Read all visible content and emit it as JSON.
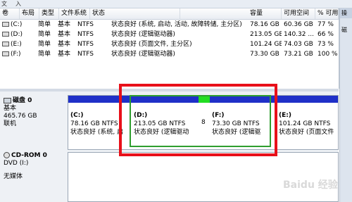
{
  "window": {
    "title_fragments": [
      "文",
      "入"
    ]
  },
  "volume_list": {
    "headers": [
      "卷",
      "布局",
      "类型",
      "文件系统",
      "状态",
      "容量",
      "可用空间",
      "% 可用"
    ],
    "rows": [
      {
        "vol": "(C:)",
        "layout": "简单",
        "type": "基本",
        "fs": "NTFS",
        "status": "状态良好 (系统, 启动, 活动, 故障转储, 主分区)",
        "capacity": "78.16 GB",
        "free": "60.36 GB",
        "pct": "77 %"
      },
      {
        "vol": "(D:)",
        "layout": "简单",
        "type": "基本",
        "fs": "NTFS",
        "status": "状态良好 (逻辑驱动器)",
        "capacity": "213.05 GB",
        "free": "140.32 ...",
        "pct": "66 %"
      },
      {
        "vol": "(E:)",
        "layout": "简单",
        "type": "基本",
        "fs": "NTFS",
        "status": "状态良好 (页面文件, 主分区)",
        "capacity": "101.24 GB",
        "free": "74.03 GB",
        "pct": "73 %"
      },
      {
        "vol": "(F:)",
        "layout": "简单",
        "type": "基本",
        "fs": "NTFS",
        "status": "状态良好 (逻辑驱动器)",
        "capacity": "73.30 GB",
        "free": "73.21 GB",
        "pct": "100 %"
      }
    ]
  },
  "actions": {
    "header": "操",
    "item": "磁"
  },
  "disk0": {
    "name": "磁盘 0",
    "type": "基本",
    "size": "465.76 GB",
    "state": "联机",
    "partitions": [
      {
        "label": "(C:)",
        "size": "78.16 GB NTFS",
        "status": "状态良好 (系统, 启",
        "bar": "#1f30c8"
      },
      {
        "label": "(D:)",
        "size": "213.05 GB NTFS",
        "status": "状态良好 (逻辑驱动",
        "bar": "#1f30c8"
      },
      {
        "label": "",
        "size": "8",
        "status": "",
        "bar": "#22dd22"
      },
      {
        "label": "(F:)",
        "size": "73.30 GB NTFS",
        "status": "状态良好 (逻辑驱",
        "bar": "#1f30c8"
      },
      {
        "label": "(E:)",
        "size": "101.24 GB NTFS",
        "status": "状态良好 (页面文件",
        "bar": "#1f30c8"
      }
    ]
  },
  "cdrom0": {
    "name": "CD-ROM 0",
    "type": "DVD (I:)",
    "state": "无媒体"
  },
  "watermark": "Baidu 经验"
}
